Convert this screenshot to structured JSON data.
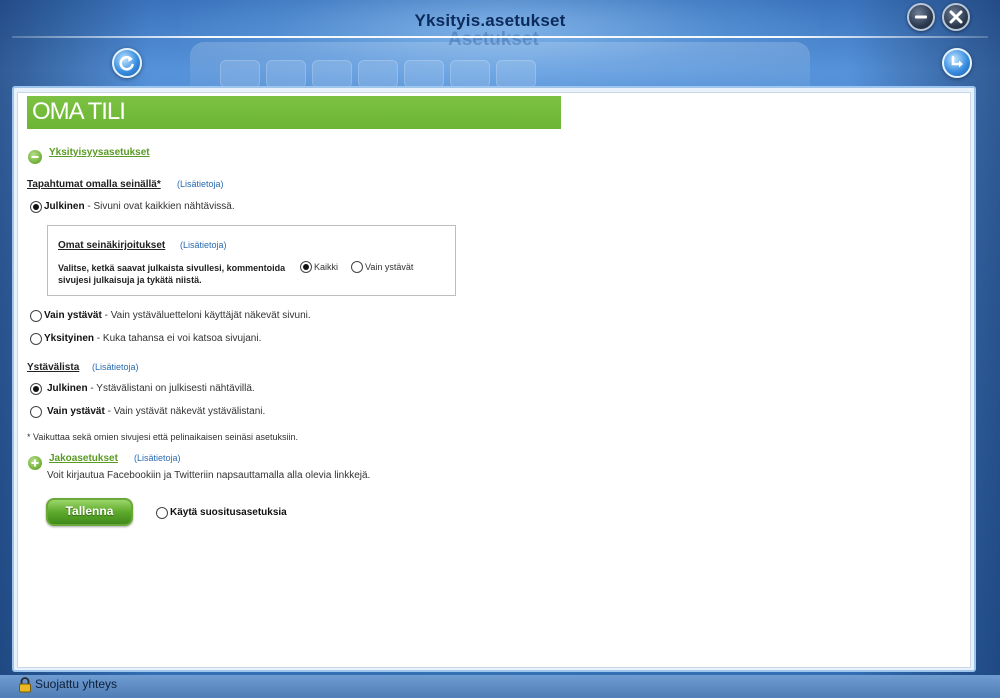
{
  "window": {
    "title": "Yksityis.asetukset",
    "ghost_title": "Asetukset"
  },
  "banner": {
    "title": "OMA TILI"
  },
  "privacy_section": {
    "title": "Yksityisyysasetukset",
    "wall_events": {
      "label": "Tapahtumat omalla seinällä*",
      "info": "(Lisätietoja)",
      "options": [
        {
          "bold": "Julkinen",
          "desc": " - Sivuni ovat kaikkien nähtävissä.",
          "checked": true
        },
        {
          "bold": "Vain ystävät",
          "desc": " - Vain ystäväluetteloni käyttäjät näkevät sivuni.",
          "checked": false
        },
        {
          "bold": "Yksityinen",
          "desc": " - Kuka tahansa ei voi katsoa sivujani.",
          "checked": false
        }
      ]
    },
    "own_posts": {
      "label": "Omat seinäkirjoitukset",
      "info": "(Lisätietoja)",
      "description": "Valitse, ketkä saavat julkaista sivullesi, kommentoida sivujesi julkaisuja ja tykätä niistä.",
      "options": [
        {
          "label": "Kaikki",
          "checked": true
        },
        {
          "label": "Vain ystävät",
          "checked": false
        }
      ]
    },
    "friend_list": {
      "label": "Ystävälista",
      "info": "(Lisätietoja)",
      "options": [
        {
          "bold": "Julkinen",
          "desc": " - Ystävälistani on julkisesti nähtävillä.",
          "checked": true
        },
        {
          "bold": "Vain ystävät",
          "desc": " - Vain ystävät näkevät ystävälistani.",
          "checked": false
        }
      ]
    },
    "footnote": "* Vaikuttaa sekä omien sivujesi että pelinaikaisen seinäsi asetuksiin."
  },
  "sharing_section": {
    "title": "Jakoasetukset",
    "info": "(Lisätietoja)",
    "description": "Voit kirjautua Facebookiin ja Twitteriin napsauttamalla alla olevia linkkejä."
  },
  "actions": {
    "save": "Tallenna",
    "recommended": "Käytä suositusasetuksia"
  },
  "status": {
    "text": "Suojattu yhteys"
  },
  "colors": {
    "banner": "#7cc143",
    "link_green": "#5a9a24",
    "info_blue": "#2a6bb0",
    "frame_blue": "#3d79c2"
  },
  "icons": {
    "minimize": "minimize-icon",
    "close": "close-icon",
    "back": "refresh-back-icon",
    "download": "download-icon",
    "collapse": "minus-circle-icon",
    "expand": "plus-circle-icon",
    "lock": "lock-icon"
  }
}
